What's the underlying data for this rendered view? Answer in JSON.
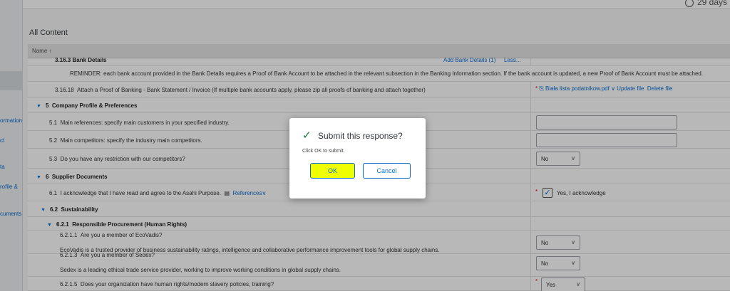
{
  "header": {
    "days_left": "29 days"
  },
  "sidebar": {
    "items": [
      {
        "label": "ormation"
      },
      {
        "label": "ct"
      },
      {
        "label": "ta"
      },
      {
        "label": "rofile &"
      },
      {
        "label": "cuments"
      }
    ]
  },
  "page": {
    "title": "All Content",
    "column_name": "Name ↑"
  },
  "rows": {
    "bank_details": {
      "label": "3.16.3   Bank Details",
      "link": "Add Bank Details (1)",
      "less": "Less..."
    },
    "reminder": {
      "text": "REMINDER: each bank account provided in the Bank Details requires a Proof of Bank Account to be attached in the relevant subsection in the Banking Information section. If the bank account is updated, a new Proof of Bank Account must be attached."
    },
    "proof": {
      "number": "3.16.18",
      "text": "Attach a Proof of Banking - Bank Statement / Invoice (If multiple bank accounts apply, please zip all proofs of banking and attach together)",
      "file": "Biała lista podatnikow.pdf",
      "update": "Update file",
      "delete": "Delete file"
    },
    "s5": {
      "number": "5",
      "label": "Company Profile & Preferences"
    },
    "q51": {
      "number": "5.1",
      "text": "Main references: specify main customers in your specified industry."
    },
    "q52": {
      "number": "5.2",
      "text": "Main competitors: specify the industry main competitors."
    },
    "q53": {
      "number": "5.3",
      "text": "Do you have any restriction with our competitors?",
      "value": "No"
    },
    "s6": {
      "number": "6",
      "label": "Supplier Documents"
    },
    "q61": {
      "number": "6.1",
      "text": "I acknowledge that I have read and agree to the Asahi Purpose.",
      "references": "References",
      "answer": "Yes, I acknowledge"
    },
    "s62": {
      "number": "6.2",
      "label": "Sustainability"
    },
    "s621": {
      "number": "6.2.1",
      "label": "Responsible Procurement (Human Rights)"
    },
    "q6211": {
      "number": "6.2.1.1",
      "text": "Are you a member of EcoVadis?",
      "desc": "EcoVadis is a trusted provider of business sustainability ratings, intelligence and collaborative performance improvement tools for global supply chains.",
      "value": "No"
    },
    "q6213": {
      "number": "6.2.1.3",
      "text": "Are you a member of Sedex?",
      "desc": "Sedex is a leading ethical trade service provider, working to improve working conditions in global supply chains.",
      "value": "No"
    },
    "q6215": {
      "number": "6.2.1.5",
      "text": "Does your organization have human rights/modern slavery policies, training?",
      "value": "Yes"
    }
  },
  "dialog": {
    "title": "Submit this response?",
    "message": "Click OK to submit.",
    "ok": "OK",
    "cancel": "Cancel"
  },
  "colors": {
    "accent": "#0a6ed1",
    "highlight": "#f0ff00",
    "success": "#107e3e",
    "required": "#d9000f"
  }
}
